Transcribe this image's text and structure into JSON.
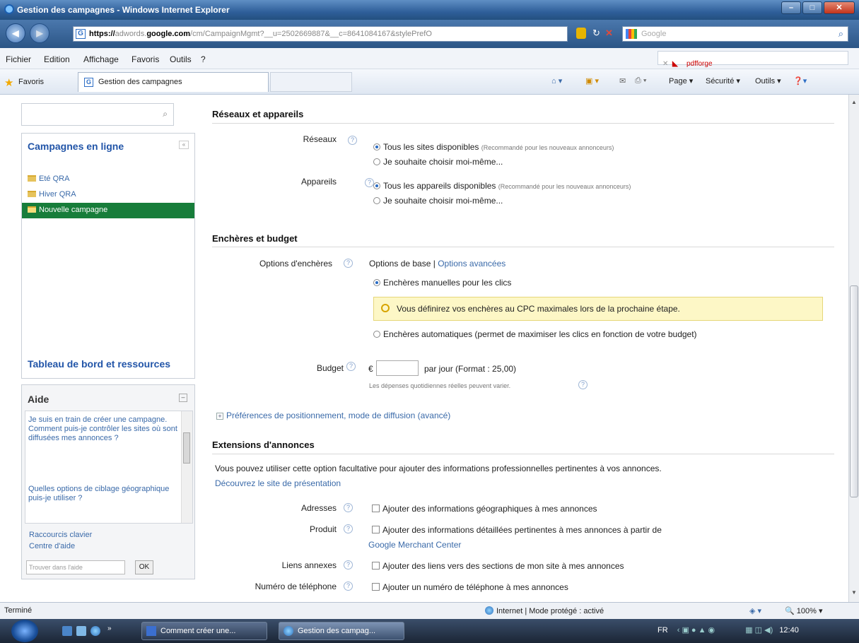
{
  "window": {
    "title": "Gestion des campagnes - Windows Internet Explorer"
  },
  "address": {
    "prefix": "https://",
    "host_dim": "adwords.",
    "host_bold": "google.com",
    "rest": "/cm/CampaignMgmt?__u=2502669887&__c=8641084167&stylePrefO",
    "search_placeholder": "Google"
  },
  "menu": [
    "Fichier",
    "Edition",
    "Affichage",
    "Favoris",
    "Outils",
    "?"
  ],
  "pdfforge": "pdfforge",
  "favbar": {
    "favorites": "Favoris",
    "tab_title": "Gestion des campagnes",
    "commands": [
      "Page ▾",
      "Sécurité ▾",
      "Outils ▾"
    ]
  },
  "sidebar": {
    "campaigns_title": "Campagnes en ligne",
    "campaigns": [
      {
        "label": "Eté QRA"
      },
      {
        "label": "Hiver QRA"
      },
      {
        "label": "Nouvelle campagne"
      }
    ],
    "dashboard_link": "Tableau de bord et ressources",
    "help": {
      "title": "Aide",
      "articles": [
        "Je suis en train de créer une campagne. Comment puis-je contrôler les sites où sont diffusées mes annonces ?",
        "Quelles options de ciblage géographique puis-je utiliser ?"
      ],
      "shortcuts": "Raccourcis clavier",
      "center": "Centre d'aide",
      "search_placeholder": "Trouver dans l'aide",
      "ok": "OK"
    }
  },
  "networks": {
    "title": "Réseaux et appareils",
    "networks_label": "Réseaux",
    "networks_opt1": "Tous les sites disponibles",
    "networks_opt1_note": "(Recommandé pour les nouveaux annonceurs)",
    "networks_opt2": "Je souhaite choisir moi-même...",
    "devices_label": "Appareils",
    "devices_opt1": "Tous les appareils disponibles",
    "devices_opt1_note": "(Recommandé pour les nouveaux annonceurs)",
    "devices_opt2": "Je souhaite choisir moi-même..."
  },
  "bidding": {
    "title": "Enchères et budget",
    "options_label": "Options d'enchères",
    "basic": "Options de base",
    "sep": "|",
    "advanced": "Options avancées",
    "manual": "Enchères manuelles pour les clics",
    "info": "Vous définirez vos enchères au CPC maximales lors de la prochaine étape.",
    "auto": "Enchères automatiques (permet de maximiser les clics en fonction de votre budget)",
    "budget_label": "Budget",
    "currency": "€",
    "budget_value": "",
    "per_day": "par jour (Format : 25,00)",
    "budget_note": "Les dépenses quotidiennes réelles peuvent varier.",
    "prefs": "Préférences de positionnement, mode de diffusion (avancé)"
  },
  "extensions": {
    "title": "Extensions d'annonces",
    "intro": "Vous pouvez utiliser cette option facultative pour ajouter des informations professionnelles pertinentes à vos annonces.",
    "discover": "Découvrez le site de présentation",
    "address_label": "Adresses",
    "address_opt": "Ajouter des informations géographiques à mes annonces",
    "product_label": "Produit",
    "product_opt": "Ajouter des informations détaillées pertinentes à mes annonces à partir de",
    "product_link": "Google Merchant Center",
    "links_label": "Liens annexes",
    "links_opt": "Ajouter des liens vers des sections de mon site à mes annonces",
    "phone_label": "Numéro de téléphone",
    "phone_opt": "Ajouter un numéro de téléphone à mes annonces"
  },
  "status": {
    "left": "Terminé",
    "zone": "Internet | Mode protégé : activé",
    "zoom": "100%"
  },
  "taskbar": {
    "tasks": [
      "Comment créer une...",
      "Gestion des campag..."
    ],
    "lang": "FR",
    "time": "12:40"
  }
}
